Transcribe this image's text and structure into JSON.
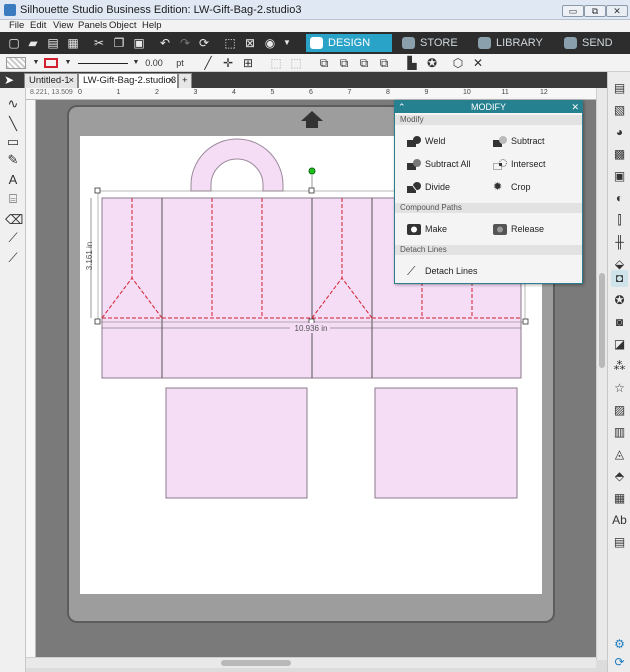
{
  "window": {
    "title": "Silhouette Studio Business Edition: LW-Gift-Bag-2.studio3",
    "minimize": "▭",
    "restore": "⧉",
    "close": "✕"
  },
  "menu": [
    "File",
    "Edit",
    "View",
    "Panels",
    "Object",
    "Help"
  ],
  "nav": {
    "design": "DESIGN",
    "store": "STORE",
    "library": "LIBRARY",
    "send": "SEND"
  },
  "line": {
    "width": "0.00",
    "unit": "pt"
  },
  "tabs": [
    {
      "label": "Untitled-1",
      "close": "×"
    },
    {
      "label": "LW-Gift-Bag-2.studio3",
      "close": "×"
    },
    {
      "label": "+"
    }
  ],
  "ruler": {
    "coords": "8.221, 13.509",
    "h_ticks": [
      "0",
      "1",
      "2",
      "3",
      "4",
      "5",
      "6",
      "7",
      "8",
      "9",
      "10",
      "11",
      "12"
    ]
  },
  "dimensions": {
    "height": "3.161 in",
    "width": "10.936 in"
  },
  "modify_panel": {
    "title": "MODIFY",
    "close": "✕",
    "sections": {
      "modify": "Modify",
      "compound": "Compound Paths",
      "detach": "Detach Lines"
    },
    "ops": {
      "weld": "Weld",
      "subtract": "Subtract",
      "subtract_all": "Subtract All",
      "intersect": "Intersect",
      "divide": "Divide",
      "crop": "Crop",
      "make": "Make",
      "release": "Release",
      "detach_lines": "Detach Lines"
    }
  },
  "colors": {
    "accent": "#29a3c8",
    "panel_header": "#25818f",
    "shape_fill": "#f5ddf6",
    "cut_line": "#d21f2f"
  }
}
